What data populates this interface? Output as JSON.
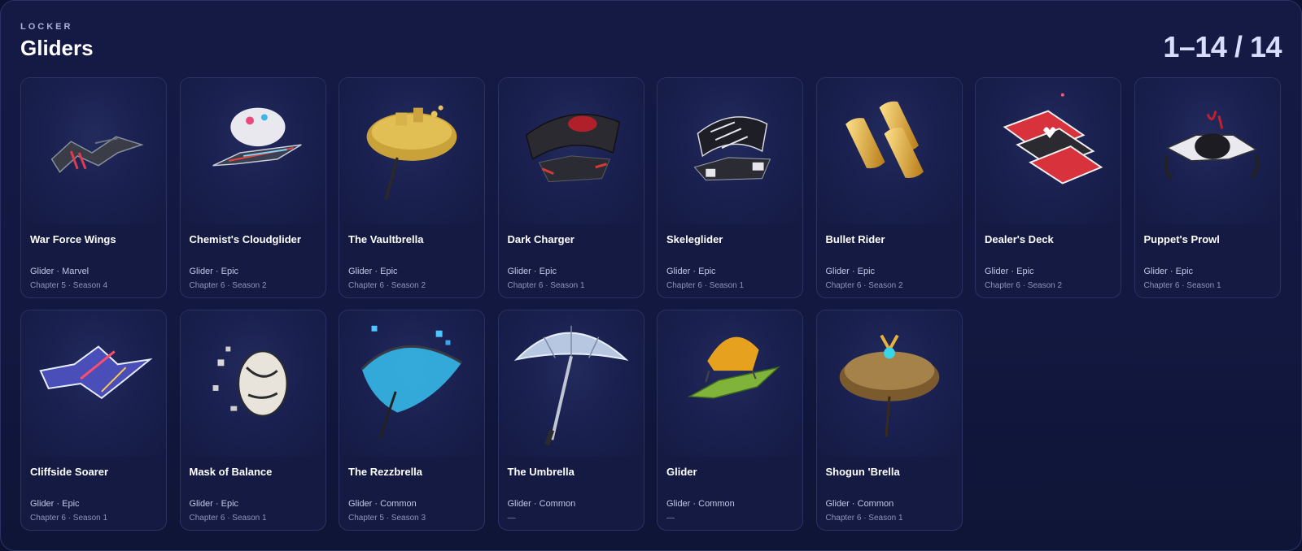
{
  "header": {
    "eyebrow": "LOCKER",
    "title": "Gliders",
    "counter": "1–14 / 14"
  },
  "items": [
    {
      "name": "War Force Wings",
      "type": "Glider",
      "rarity": "Marvel",
      "season": "Chapter 5 · Season 4",
      "icon": "war-force-wings-icon"
    },
    {
      "name": "Chemist's Cloudglider",
      "type": "Glider",
      "rarity": "Epic",
      "season": "Chapter 6 · Season 2",
      "icon": "chemists-cloudglider-icon"
    },
    {
      "name": "The Vaultbrella",
      "type": "Glider",
      "rarity": "Epic",
      "season": "Chapter 6 · Season 2",
      "icon": "vaultbrella-icon"
    },
    {
      "name": "Dark Charger",
      "type": "Glider",
      "rarity": "Epic",
      "season": "Chapter 6 · Season 1",
      "icon": "dark-charger-icon"
    },
    {
      "name": "Skeleglider",
      "type": "Glider",
      "rarity": "Epic",
      "season": "Chapter 6 · Season 1",
      "icon": "skeleglider-icon"
    },
    {
      "name": "Bullet Rider",
      "type": "Glider",
      "rarity": "Epic",
      "season": "Chapter 6 · Season 2",
      "icon": "bullet-rider-icon"
    },
    {
      "name": "Dealer's Deck",
      "type": "Glider",
      "rarity": "Epic",
      "season": "Chapter 6 · Season 2",
      "icon": "dealers-deck-icon"
    },
    {
      "name": "Puppet's Prowl",
      "type": "Glider",
      "rarity": "Epic",
      "season": "Chapter 6 · Season 1",
      "icon": "puppets-prowl-icon"
    },
    {
      "name": "Cliffside Soarer",
      "type": "Glider",
      "rarity": "Epic",
      "season": "Chapter 6 · Season 1",
      "icon": "cliffside-soarer-icon"
    },
    {
      "name": "Mask of Balance",
      "type": "Glider",
      "rarity": "Epic",
      "season": "Chapter 6 · Season 1",
      "icon": "mask-of-balance-icon"
    },
    {
      "name": "The Rezzbrella",
      "type": "Glider",
      "rarity": "Common",
      "season": "Chapter 5 · Season 3",
      "icon": "rezzbrella-icon"
    },
    {
      "name": "The Umbrella",
      "type": "Glider",
      "rarity": "Common",
      "season": "—",
      "icon": "umbrella-icon"
    },
    {
      "name": "Glider",
      "type": "Glider",
      "rarity": "Common",
      "season": "—",
      "icon": "glider-icon"
    },
    {
      "name": "Shogun 'Brella",
      "type": "Glider",
      "rarity": "Common",
      "season": "Chapter 6 · Season 1",
      "icon": "shogun-brella-icon"
    }
  ]
}
